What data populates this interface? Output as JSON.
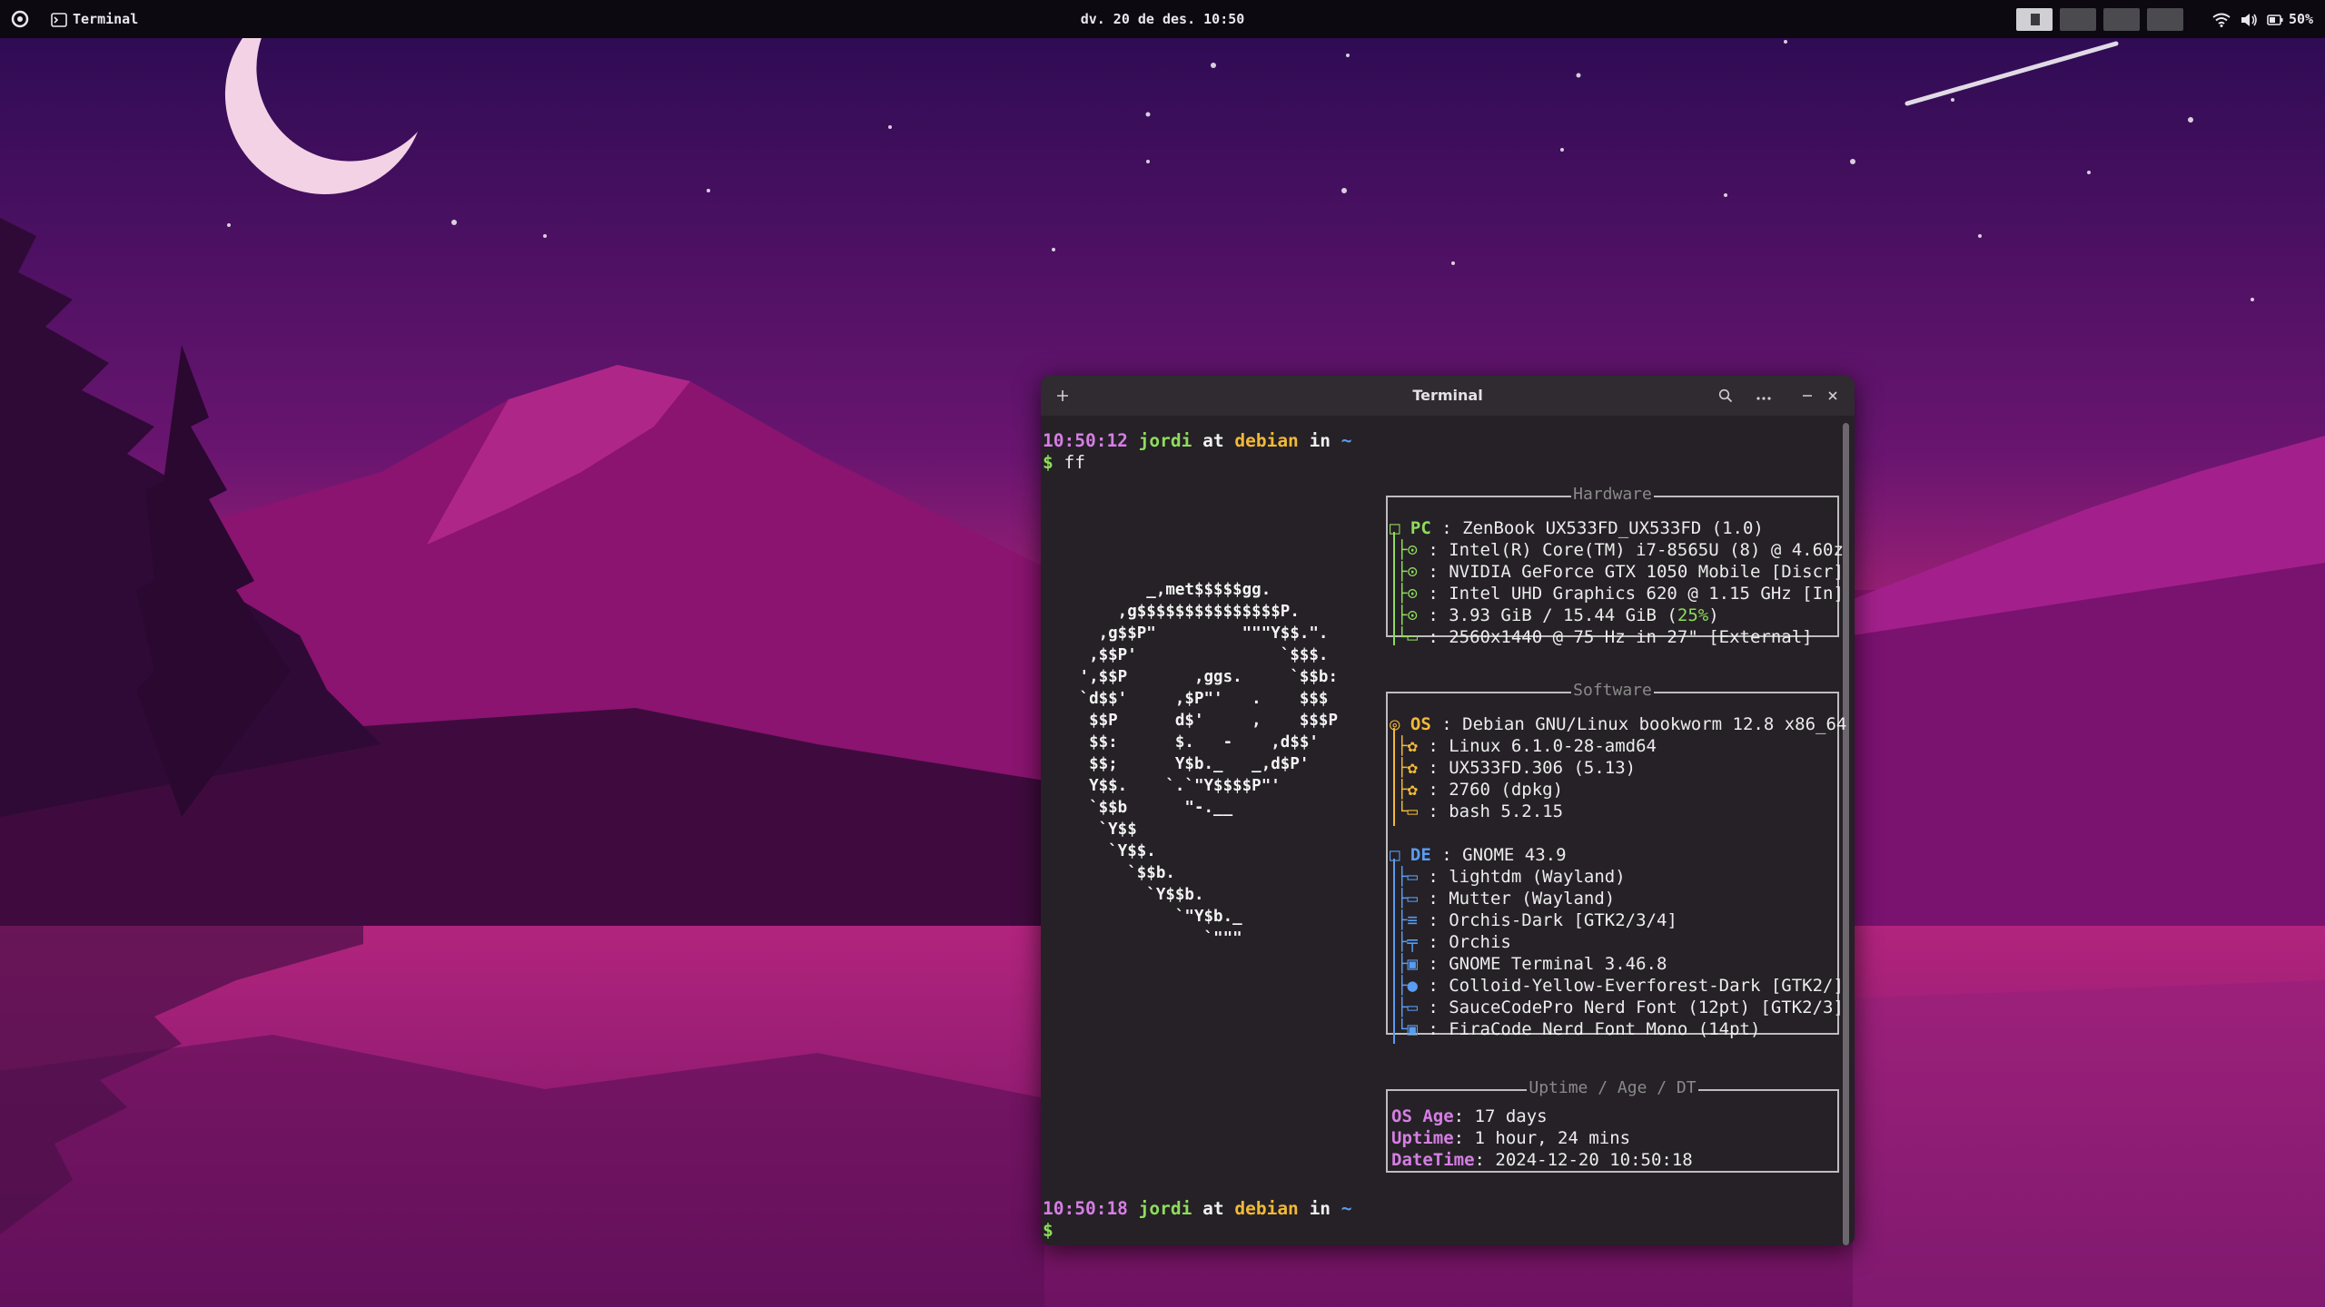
{
  "topbar": {
    "app_name": "Terminal",
    "datetime": "dv. 20 de des. 10:50",
    "battery": "50%"
  },
  "terminal": {
    "title": "Terminal",
    "prompt1": {
      "time": "10:50:12",
      "user": "jordi",
      "at": "at",
      "host": "debian",
      "in": "in",
      "dir": "~"
    },
    "command": "ff",
    "prompt2": {
      "time": "10:50:18",
      "user": "jordi",
      "at": "at",
      "host": "debian",
      "in": "in",
      "dir": "~"
    },
    "dollar": "$",
    "hardware": {
      "caption": "Hardware",
      "head_label": "PC",
      "rows": [
        "ZenBook UX533FD_UX533FD (1.0)",
        "Intel(R) Core(TM) i7-8565U (8) @ 4.60z",
        "NVIDIA GeForce GTX 1050 Mobile [Discr]",
        "Intel UHD Graphics 620 @ 1.15 GHz [In]",
        "3.93 GiB / 15.44 GiB (",
        "2560x1440 @ 75 Hz in 27\" [External]"
      ],
      "mem_percent": "25%",
      "mem_close": ")"
    },
    "software": {
      "caption": "Software",
      "os_label": "OS",
      "os_rows": [
        "Debian GNU/Linux bookworm 12.8 x86_64",
        "Linux 6.1.0-28-amd64",
        "UX533FD.306 (5.13)",
        "2760 (dpkg)",
        "bash 5.2.15"
      ],
      "de_label": "DE",
      "de_rows": [
        "GNOME 43.9",
        "lightdm (Wayland)",
        "Mutter (Wayland)",
        "Orchis-Dark [GTK2/3/4]",
        "Orchis",
        "GNOME Terminal 3.46.8",
        "Colloid-Yellow-Everforest-Dark [GTK2/]",
        "SauceCodePro Nerd Font (12pt) [GTK2/3]",
        "FiraCode Nerd Font Mono (14pt)"
      ]
    },
    "uptime": {
      "caption": "Uptime / Age / DT",
      "os_age_label": "OS Age",
      "os_age": "17 days",
      "uptime_label": "Uptime",
      "uptime": "1 hour, 24 mins",
      "datetime_label": "DateTime",
      "datetime": "2024-12-20 10:50:18"
    },
    "logo_lines": [
      "        _,met$$$$$gg.",
      "     ,g$$$$$$$$$$$$$$$P.",
      "   ,g$$P\"         \"\"\"Y$$.\".",
      "  ,$$P'               `$$$.",
      " ',$$P       ,ggs.     `$$b:",
      " `d$$'     ,$P\"'   .    $$$",
      "  $$P      d$'     ,    $$$P",
      "  $$:      $.   -    ,d$$'",
      "  $$;      Y$b._   _,d$P'",
      "  Y$$.    `.`\"Y$$$$P\"'",
      "  `$$b      \"-.__",
      "   `Y$$",
      "    `Y$$.",
      "      `$$b.",
      "        `Y$$b.",
      "           `\"Y$b._",
      "              `\"\"\""
    ]
  },
  "colors": {
    "purple": "#d57ee3",
    "green": "#8fdc5c",
    "yellow": "#f1b93a",
    "blue": "#5a9cf0",
    "logo_red": "#e04646"
  }
}
